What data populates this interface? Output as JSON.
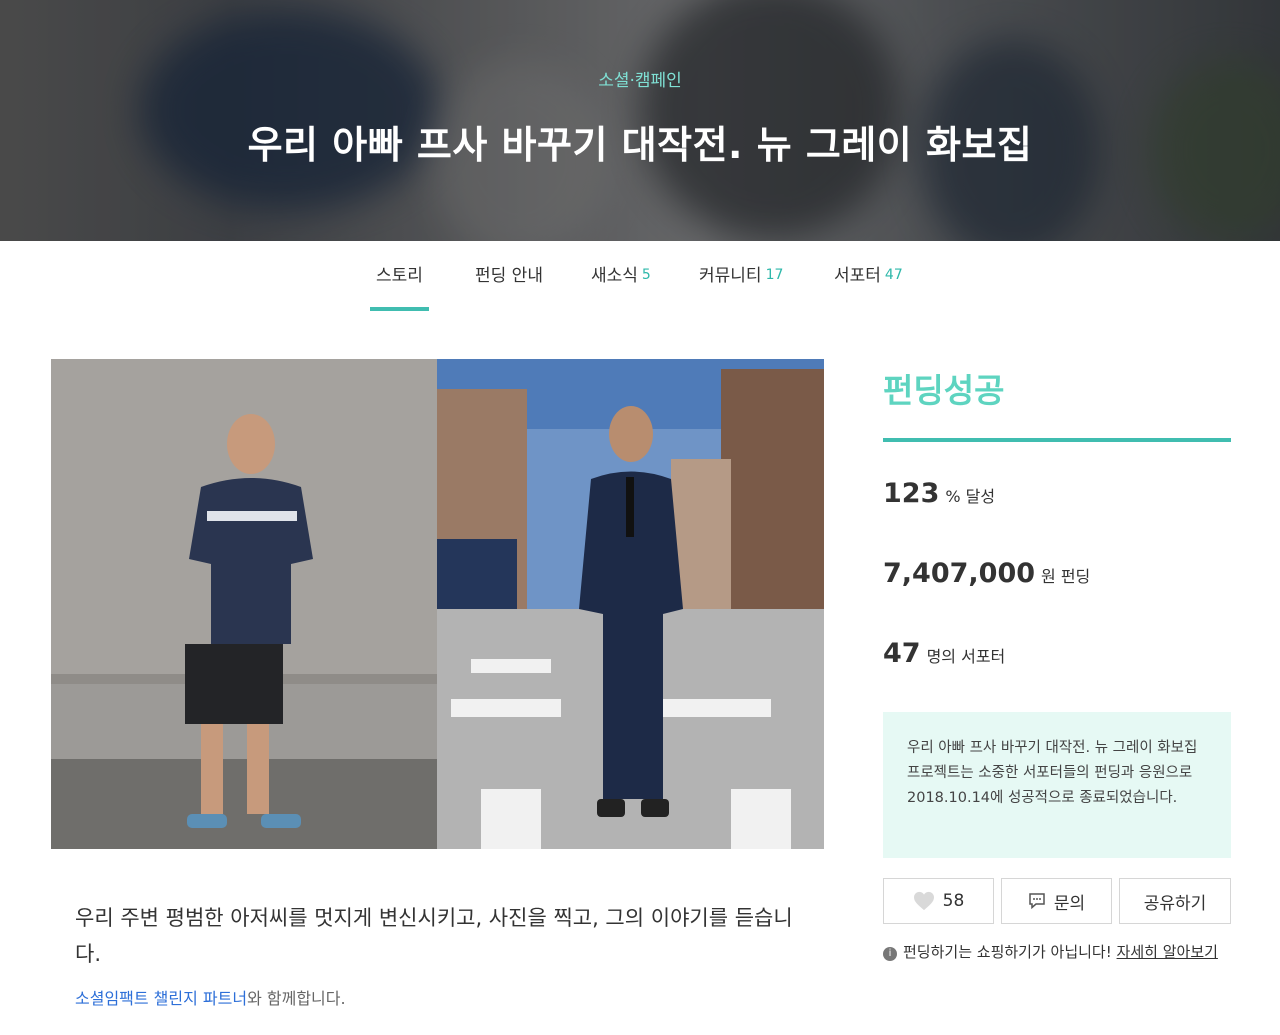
{
  "hero": {
    "category": "소셜·캠페인",
    "title": "우리 아빠 프사 바꾸기 대작전. 뉴 그레이 화보집"
  },
  "tabs": [
    {
      "label": "스토리",
      "count": ""
    },
    {
      "label": "펀딩 안내",
      "count": ""
    },
    {
      "label": "새소식",
      "count": "5"
    },
    {
      "label": "커뮤니티",
      "count": "17"
    },
    {
      "label": "서포터",
      "count": "47"
    }
  ],
  "story": {
    "lead": "우리 주변 평범한 아저씨를 멋지게 변신시키고, 사진을 찍고, 그의 이야기를 듣습니다.",
    "partner_link": "소셜임팩트 챌린지 파트너",
    "partner_suffix": "와 함께합니다."
  },
  "panel": {
    "status": "펀딩성공",
    "achieved": {
      "value": "123",
      "unit": "% 달성"
    },
    "amount": {
      "value": "7,407,000",
      "unit": "원 펀딩"
    },
    "supporters": {
      "value": "47",
      "unit": "명의 서포터"
    },
    "notice": "우리 아빠 프사 바꾸기 대작전. 뉴 그레이 화보집 프로젝트는 소중한 서포터들의 펀딩과 응원으로 2018.10.14에 성공적으로 종료되었습니다.",
    "like_count": "58",
    "inquiry_label": "문의",
    "share_label": "공유하기",
    "faq_text": "펀딩하기는 쇼핑하기가 아닙니다!",
    "faq_link": "자세히 알아보기"
  },
  "icons": {
    "like": "heart-icon",
    "inquiry": "speech-bubble-icon",
    "info": "info-icon"
  },
  "colors": {
    "accent": "#40bdb0",
    "status": "#5ed4c0",
    "link": "#2d6fd8",
    "notice_bg": "#e6f9f4"
  }
}
